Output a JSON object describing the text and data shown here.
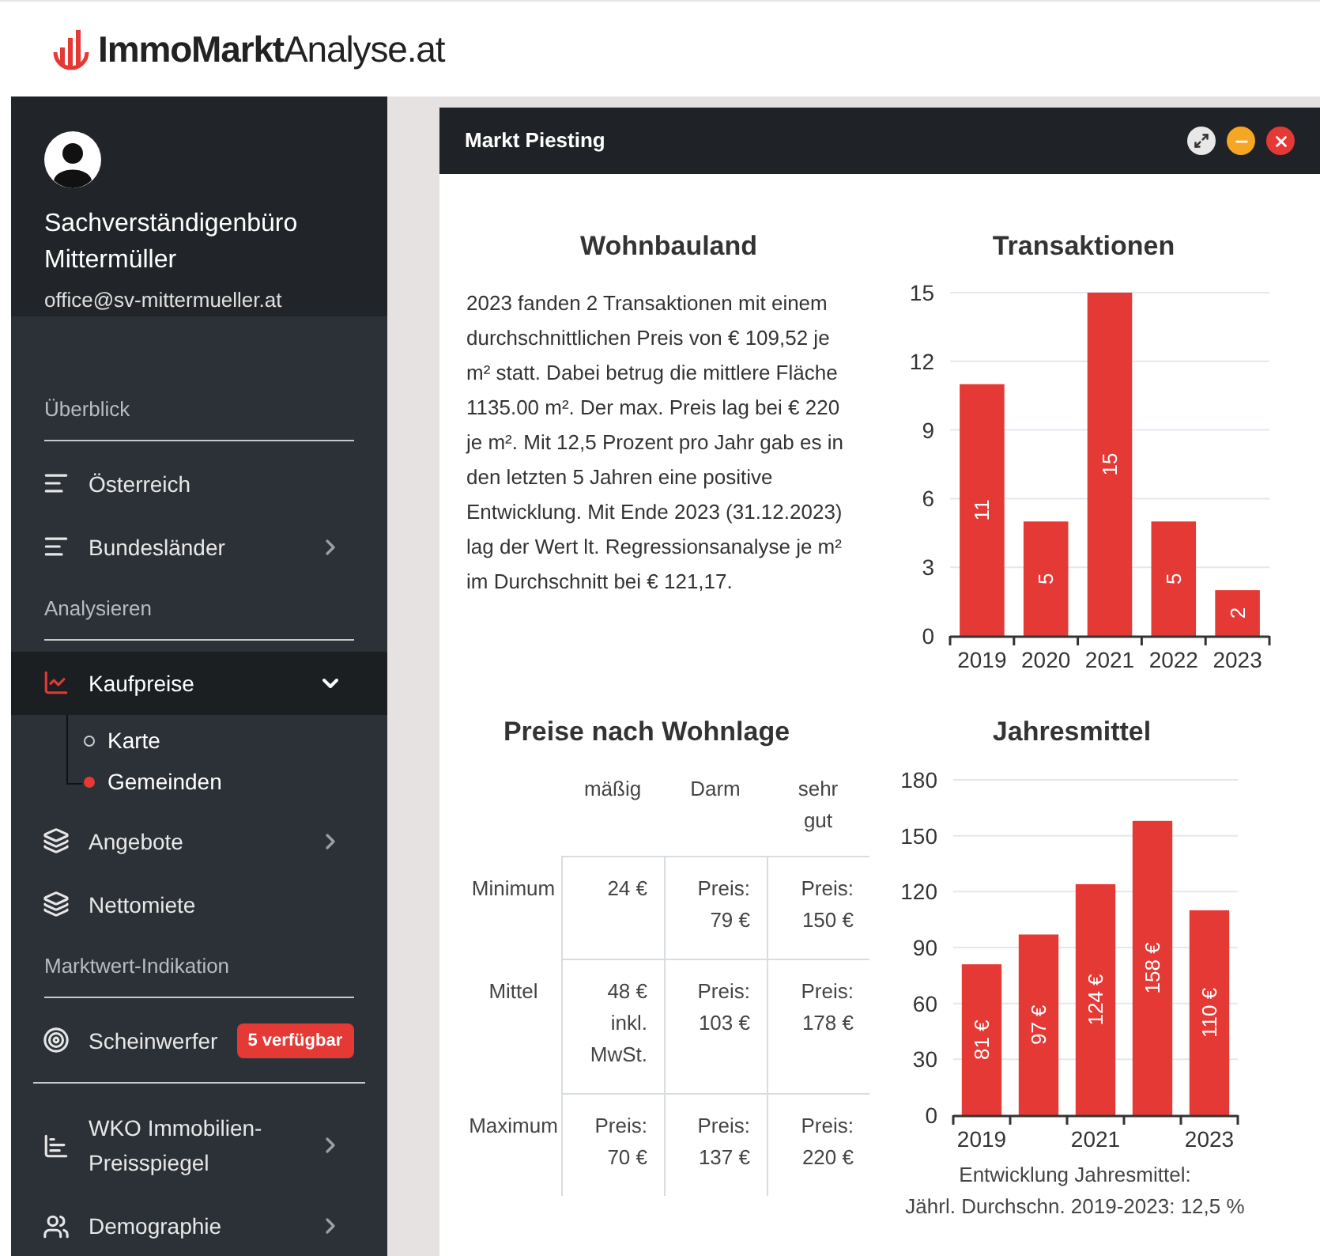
{
  "header": {
    "logo_text": "**ImmoMarkt**Analyse.at"
  },
  "sidebar": {
    "profile": {
      "name": "Sachverständigenbüro Mittermüller",
      "email": "office@sv-mittermueller.at"
    },
    "sections": [
      {
        "title": "Überblick",
        "items": [
          {
            "label": "Österreich",
            "selected": false
          },
          {
            "label": "Bundesländer",
            "selected": false,
            "expanded": false
          }
        ]
      },
      {
        "title": "Analysieren",
        "items": [
          {
            "label": "Kaufpreise",
            "selected": true,
            "expanded": true,
            "children": [
              {
                "label": "Karte",
                "selected": false
              },
              {
                "label": "Gemeinden",
                "selected": true
              }
            ]
          },
          {
            "label": "Angebote",
            "selected": false,
            "expanded": false
          },
          {
            "label": "Nettomiete",
            "selected": false
          }
        ]
      },
      {
        "title": "Marktwert-Indikation",
        "items": [
          {
            "label": "Scheinwerfer",
            "selected": false,
            "badge": "5 verfügbar"
          }
        ]
      },
      {
        "items": [
          {
            "label": "WKO Immobilien-Preisspiegel",
            "selected": false,
            "expanded": false
          },
          {
            "label": "Demographie",
            "selected": false,
            "expanded": false
          }
        ]
      }
    ]
  },
  "window": {
    "title": "Markt Piesting",
    "summary": {
      "title": "Wohnbauland",
      "text": "2023 fanden 2 Transaktionen mit einem durchschnittlichen Preis von € 109,52 je m² statt. Dabei betrug die mittlere Fläche 1135.00 m². Der max. Preis lag bei € 220 je m². Mit 12,5 Prozent pro Jahr gab es in den letzten 5 Jahren eine positive Entwicklung. Mit Ende 2023 (31.12.2023) lag der Wert lt. Regressionsanalyse je m² im Durchschnitt bei € 121,17."
    },
    "transactions": {
      "chart_data": {
        "type": "bar",
        "title": "Transaktionen",
        "categories": [
          "2019",
          "2020",
          "2021",
          "2022",
          "2023"
        ],
        "values": [
          11,
          5,
          15,
          5,
          2
        ],
        "ylim": [
          0,
          15
        ],
        "grid": true,
        "yticks": [
          0,
          3,
          6,
          9,
          12,
          15
        ],
        "data_labels": true
      }
    },
    "price_table": {
      "title": "Preise nach Wohnlage",
      "columns": [
        "mäßig",
        "Darm",
        "sehr gut"
      ],
      "rows": [
        {
          "label": "Minimum",
          "cells": [
            "24 €",
            "Preis: 79 €",
            "Preis: 150 €"
          ]
        },
        {
          "label": "Mittel",
          "cells": [
            "48 € inkl. MwSt.",
            "Preis: 103 €",
            "Preis: 178 €"
          ]
        },
        {
          "label": "Maximum",
          "cells": [
            "Preis: 70 €",
            "Preis: 137 €",
            "Preis: 220 €"
          ]
        }
      ]
    },
    "annual_mean": {
      "chart_data": {
        "type": "bar",
        "title": "Jahresmittel",
        "x": [
          2019,
          2020,
          2021,
          2022,
          2023
        ],
        "values": [
          81,
          97,
          124,
          158,
          110
        ],
        "xlim": [
          2018.5,
          2023.5
        ],
        "ylim": [
          0,
          180
        ],
        "grid": true,
        "yticks": [
          0,
          30,
          60,
          90,
          120,
          150,
          180
        ],
        "xticks": [
          2019,
          2021,
          2023
        ],
        "value_labels": [
          "81 €",
          "97 €",
          "124 €",
          "158 €",
          "110 €"
        ]
      },
      "note": [
        "Entwicklung Jahresmittel:",
        "Jährl. Durchschn. 2019-2023: 12,5 %"
      ]
    }
  }
}
